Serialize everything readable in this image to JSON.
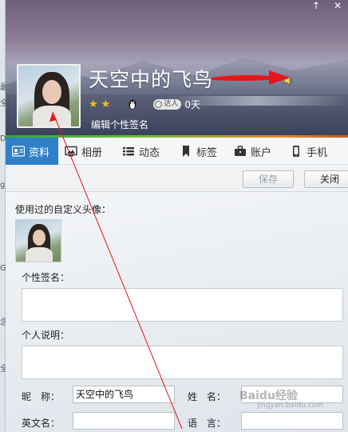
{
  "window": {
    "up_glyph": "↑",
    "close_glyph": "✕"
  },
  "profile": {
    "nickname": "天空中的飞鸟",
    "stars": [
      "★",
      "★"
    ],
    "daren_label": "达人",
    "days_label": "0天",
    "edit_signature": "编辑个性签名"
  },
  "tabs": [
    {
      "label": "资料",
      "icon": "profile-card-icon"
    },
    {
      "label": "相册",
      "icon": "photo-album-icon"
    },
    {
      "label": "动态",
      "icon": "feed-list-icon"
    },
    {
      "label": "标签",
      "icon": "bookmark-icon"
    },
    {
      "label": "账户",
      "icon": "briefcase-icon"
    },
    {
      "label": "手机",
      "icon": "phone-icon"
    }
  ],
  "toolbar": {
    "save_label": "保存",
    "close_label": "关闭"
  },
  "form": {
    "used_avatar_label": "使用过的自定义头像：",
    "signature_label": "个性签名：",
    "description_label": "个人说明：",
    "nickname_label": "昵　称：",
    "nickname_value": "天空中的飞鸟",
    "surname_label": "姓　名：",
    "surname_value": "",
    "english_name_label": "英文名：",
    "english_name_value": "",
    "language_label": "语　言：",
    "language_value": ""
  },
  "background_window": {
    "chars": [
      "最",
      "全",
      "D",
      "g",
      "G",
      "念",
      "全"
    ]
  },
  "watermark": {
    "main": "Baidu经验",
    "sub": "jingyan.baidu.com"
  },
  "colors": {
    "tab_active": "#2f7fc9",
    "annotation_red": "#e4161b",
    "star": "#f4c20d"
  }
}
